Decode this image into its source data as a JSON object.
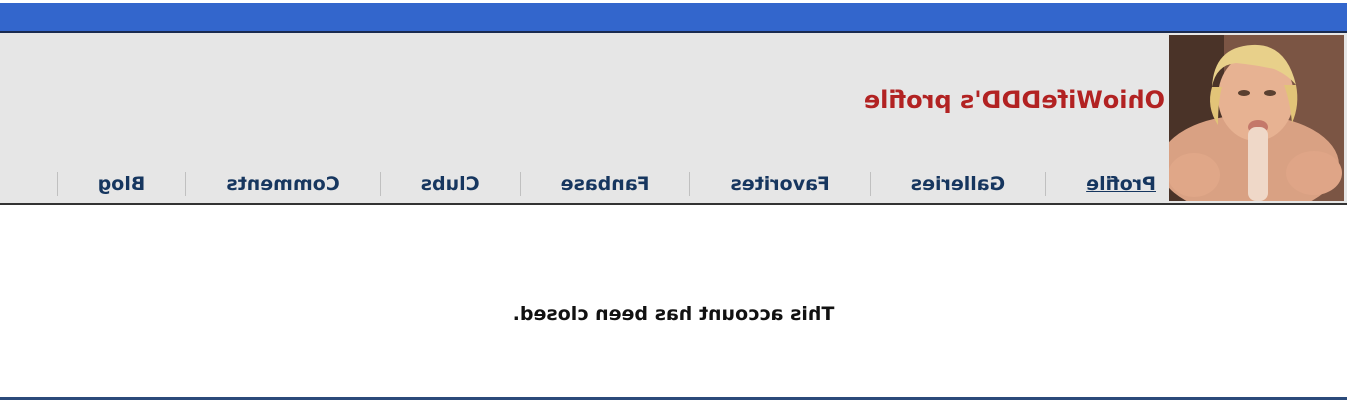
{
  "header": {
    "profile_title": "OhioWifeDDD's profile"
  },
  "nav": {
    "items": [
      {
        "label": "Profile"
      },
      {
        "label": "Galleries"
      },
      {
        "label": "Favorites"
      },
      {
        "label": "Fanbase"
      },
      {
        "label": "Clubs"
      },
      {
        "label": "Comments"
      },
      {
        "label": "Blog"
      }
    ]
  },
  "main": {
    "message": "This account has been closed."
  },
  "colors": {
    "top_bar": "#3366cc",
    "header_bg": "#e6e6e6",
    "title_red": "#b22222",
    "nav_link": "#16365f"
  }
}
